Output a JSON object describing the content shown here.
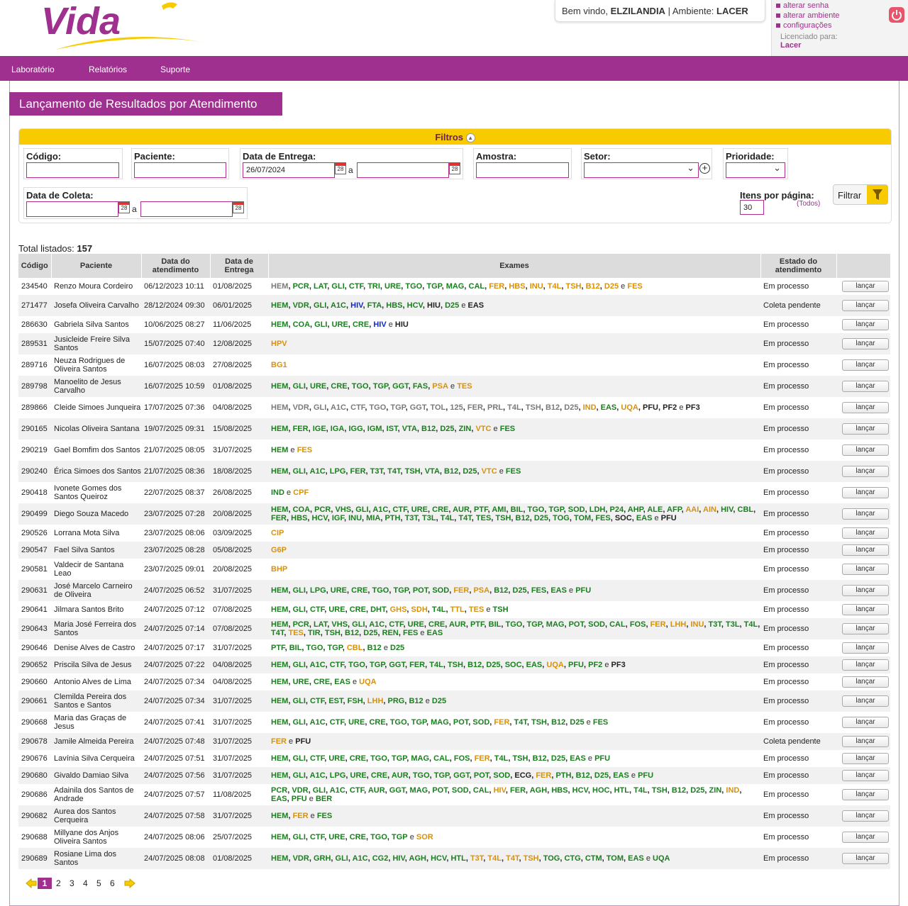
{
  "brand": {
    "logo_text": "Vida",
    "accent": "#a0308f",
    "yellow": "#f7cb00"
  },
  "header": {
    "welcome_prefix": "Bem vindo,",
    "user": "ELZILANDIA",
    "sep": "|",
    "env_label": "Ambiente:",
    "env": "LACER"
  },
  "userbox": {
    "links": [
      "alterar senha",
      "alterar ambiente",
      "configurações"
    ],
    "licensed_label": "Licenciado para:",
    "licensed_to": "Lacer",
    "power_icon": "power-icon"
  },
  "nav": [
    "Laboratório",
    "Relatórios",
    "Suporte"
  ],
  "page_title": "Lançamento de Resultados por Atendimento",
  "filters": {
    "title": "Filtros",
    "codigo": {
      "label": "Código:",
      "value": ""
    },
    "paciente": {
      "label": "Paciente:",
      "value": ""
    },
    "entrega": {
      "label": "Data de Entrega:",
      "from": "26/07/2024",
      "to": "",
      "a": "a"
    },
    "amostra": {
      "label": "Amostra:",
      "value": ""
    },
    "setor": {
      "label": "Setor:",
      "value": ""
    },
    "prioridade": {
      "label": "Prioridade:",
      "value": ""
    },
    "coleta": {
      "label": "Data de Coleta:",
      "from": "",
      "to": "",
      "a": "a"
    },
    "itens": {
      "label": "Itens por página:",
      "value": "30",
      "todos": "(Todos)"
    },
    "filtrar": "Filtrar",
    "cal_day": "28"
  },
  "total": {
    "label": "Total listados:",
    "value": "157"
  },
  "table": {
    "headers": [
      "Código",
      "Paciente",
      "Data do atendimento",
      "Data de Entrega",
      "Exames",
      "Estado do atendimento",
      ""
    ],
    "button": "lançar",
    "rows": [
      {
        "cod": "234540",
        "pac": "Renzo Moura Cordeiro",
        "dat": "06/12/2023 10:11",
        "ent": "01/08/2025",
        "ex": "HEM:a,PCR:g,LAT:g,GLI:g,CTF:g,TRI:g,URE:g,TGO:g,TGP:g,MAG:g,CAL:g,FER:o,HBS:o,INU:o,T4L:o,TSH:o,B12:o,D25:o,FES:o",
        "est": "Em processo"
      },
      {
        "cod": "271477",
        "pac": "Josefa Oliveira Carvalho",
        "dat": "28/12/2024 09:30",
        "ent": "06/01/2025",
        "ex": "HEM:g,VDR:g,GLI:g,A1C:g,HIV:b,FTA:g,HBS:g,HCV:g,HIU:k,D25:g,EAS:k",
        "est": "Coleta pendente"
      },
      {
        "cod": "286630",
        "pac": "Gabriela Silva Santos",
        "dat": "10/06/2025 08:27",
        "ent": "11/06/2025",
        "ex": "HEM:g,COA:g,GLI:g,URE:g,CRE:g,HIV:b,HIU:k",
        "est": "Em processo"
      },
      {
        "cod": "289531",
        "pac": "Jusicleide Freire Silva Santos",
        "dat": "15/07/2025 07:40",
        "ent": "12/08/2025",
        "ex": "HPV:o",
        "est": "Em processo"
      },
      {
        "cod": "289716",
        "pac": "Neuza Rodrigues de Oliveira Santos",
        "dat": "16/07/2025 08:03",
        "ent": "27/08/2025",
        "ex": "BG1:o",
        "est": "Em processo"
      },
      {
        "cod": "289798",
        "pac": "Manoelito de Jesus Carvalho",
        "dat": "16/07/2025 10:59",
        "ent": "01/08/2025",
        "ex": "HEM:g,GLI:g,URE:g,CRE:g,TGO:g,TGP:g,GGT:g,FAS:g,PSA:o,TES:o",
        "est": "Em processo"
      },
      {
        "cod": "289866",
        "pac": "Cleide Simoes Junqueira",
        "dat": "17/07/2025 07:36",
        "ent": "04/08/2025",
        "ex": "HEM:a,VDR:a,GLI:a,A1C:a,CTF:a,TGO:a,TGP:a,GGT:a,TOL:a,125:a,FER:a,PRL:a,T4L:a,TSH:a,B12:a,D25:a,IND:o,EAS:g,UQA:o,PFU:k,PF2:k,PF3:k",
        "est": "Em processo"
      },
      {
        "cod": "290165",
        "pac": "Nicolas Oliveira Santana",
        "dat": "19/07/2025 09:31",
        "ent": "15/08/2025",
        "ex": "HEM:g,FER:g,IGE:g,IGA:g,IGG:g,IGM:g,IST:g,VTA:g,B12:g,D25:g,ZIN:g,VTC:o,FES:g",
        "est": "Em processo"
      },
      {
        "cod": "290219",
        "pac": "Gael Bomfim dos Santos",
        "dat": "21/07/2025 08:05",
        "ent": "31/07/2025",
        "ex": "HEM:g,FES:o",
        "est": "Em processo"
      },
      {
        "cod": "290240",
        "pac": "Érica Simoes dos Santos",
        "dat": "21/07/2025 08:36",
        "ent": "18/08/2025",
        "ex": "HEM:g,GLI:g,A1C:g,LPG:g,FER:g,T3T:g,T4T:g,TSH:g,VTA:g,B12:g,D25:g,VTC:o,FES:g",
        "est": "Em processo"
      },
      {
        "cod": "290418",
        "pac": "Ivonete Gomes dos Santos Queiroz",
        "dat": "22/07/2025 08:37",
        "ent": "26/08/2025",
        "ex": "IND:g,CPF:o",
        "est": "Em processo"
      },
      {
        "cod": "290499",
        "pac": "Diego Souza Macedo",
        "dat": "23/07/2025 07:28",
        "ent": "20/08/2025",
        "ex": "HEM:g,COA:g,PCR:g,VHS:g,GLI:g,A1C:g,CTF:g,URE:g,CRE:g,AUR:g,PTF:g,AMI:g,BIL:g,TGO:g,TGP:g,SOD:g,LDH:g,P24:g,AHP:g,ALE:g,AFP:g,AAI:o,AIN:o,HIV:g,CBL:g,FER:g,HBS:g,HCV:g,IGF:g,INU:g,MIA:g,PTH:g,T3T:g,T3L:g,T4L:g,T4T:g,TES:g,TSH:g,B12:g,D25:g,TOG:g,TOM:g,FES:g,SOC:k,EAS:g,PFU:k",
        "est": "Em processo"
      },
      {
        "cod": "290526",
        "pac": "Lorrana Mota Silva",
        "dat": "23/07/2025 08:06",
        "ent": "03/09/2025",
        "ex": "CIP:o",
        "est": "Em processo"
      },
      {
        "cod": "290547",
        "pac": "Fael Silva Santos",
        "dat": "23/07/2025 08:28",
        "ent": "05/08/2025",
        "ex": "G6P:o",
        "est": "Em processo"
      },
      {
        "cod": "290581",
        "pac": "Valdecir de Santana Leao",
        "dat": "23/07/2025 09:01",
        "ent": "20/08/2025",
        "ex": "BHP:o",
        "est": "Em processo"
      },
      {
        "cod": "290631",
        "pac": "José Marcelo Carneiro de Oliveira",
        "dat": "24/07/2025 06:52",
        "ent": "31/07/2025",
        "ex": "HEM:g,GLI:g,LPG:g,URE:g,CRE:g,TGO:g,TGP:g,POT:g,SOD:g,FER:o,PSA:o,B12:g,D25:g,FES:g,EAS:g,PFU:g",
        "est": "Em processo"
      },
      {
        "cod": "290641",
        "pac": "Jilmara Santos Brito",
        "dat": "24/07/2025 07:12",
        "ent": "07/08/2025",
        "ex": "HEM:g,GLI:g,CTF:g,URE:g,CRE:g,DHT:g,GHS:o,SDH:o,T4L:g,TTL:o,TES:o,TSH:g",
        "est": "Em processo"
      },
      {
        "cod": "290643",
        "pac": "Maria José Ferreira dos Santos",
        "dat": "24/07/2025 07:14",
        "ent": "07/08/2025",
        "ex": "HEM:g,PCR:g,LAT:g,VHS:g,GLI:g,A1C:g,CTF:g,URE:g,CRE:g,AUR:g,PTF:g,BIL:g,TGO:g,TGP:g,MAG:g,POT:g,SOD:g,CAL:g,FOS:g,FER:o,LHH:o,INU:o,T3T:g,T3L:g,T4L:g,T4T:g,TES:o,TIR:g,TSH:g,B12:g,D25:g,REN:g,FES:g,EAS:g",
        "est": "Em processo"
      },
      {
        "cod": "290646",
        "pac": "Denise Alves de Castro",
        "dat": "24/07/2025 07:17",
        "ent": "31/07/2025",
        "ex": "PTF:g,BIL:g,TGO:g,TGP:g,CBL:o,B12:g,D25:g",
        "est": "Em processo"
      },
      {
        "cod": "290652",
        "pac": "Priscila Silva de Jesus",
        "dat": "24/07/2025 07:22",
        "ent": "04/08/2025",
        "ex": "HEM:g,GLI:g,A1C:g,CTF:g,TGO:g,TGP:g,GGT:g,FER:g,T4L:g,TSH:g,B12:g,D25:g,SOC:g,EAS:g,UQA:o,PFU:g,PF2:g,PF3:k",
        "est": "Em processo"
      },
      {
        "cod": "290660",
        "pac": "Antonio Alves de Lima",
        "dat": "24/07/2025 07:34",
        "ent": "04/08/2025",
        "ex": "HEM:g,URE:g,CRE:g,EAS:g,UQA:o",
        "est": "Em processo"
      },
      {
        "cod": "290661",
        "pac": "Clemilda Pereira dos Santos e Santos",
        "dat": "24/07/2025 07:34",
        "ent": "31/07/2025",
        "ex": "HEM:g,GLI:g,CTF:g,EST:g,FSH:g,LHH:o,PRG:g,B12:g,D25:g",
        "est": "Em processo"
      },
      {
        "cod": "290668",
        "pac": "Maria das Graças de Jesus",
        "dat": "24/07/2025 07:41",
        "ent": "31/07/2025",
        "ex": "HEM:g,GLI:g,A1C:g,CTF:g,URE:g,CRE:g,TGO:g,TGP:g,MAG:g,POT:g,SOD:g,FER:o,T4T:g,TSH:g,B12:g,D25:g,FES:g",
        "est": "Em processo"
      },
      {
        "cod": "290678",
        "pac": "Jamile Almeida Pereira",
        "dat": "24/07/2025 07:48",
        "ent": "31/07/2025",
        "ex": "FER:o,PFU:k",
        "est": "Coleta pendente"
      },
      {
        "cod": "290676",
        "pac": "Lavínia Silva Cerqueira",
        "dat": "24/07/2025 07:51",
        "ent": "31/07/2025",
        "ex": "HEM:g,GLI:g,CTF:g,URE:g,CRE:g,TGO:g,TGP:g,MAG:g,CAL:g,FOS:g,FER:o,T4L:g,TSH:g,B12:g,D25:g,EAS:g,PFU:g",
        "est": "Em processo"
      },
      {
        "cod": "290680",
        "pac": "Givaldo Damiao Silva",
        "dat": "24/07/2025 07:56",
        "ent": "31/07/2025",
        "ex": "HEM:g,GLI:g,A1C:g,LPG:g,URE:g,CRE:g,AUR:g,TGO:g,TGP:g,GGT:g,POT:g,SOD:g,ECG:k,FER:o,PTH:g,B12:g,D25:g,EAS:g,PFU:g",
        "est": "Em processo"
      },
      {
        "cod": "290686",
        "pac": "Adainila dos Santos de Andrade",
        "dat": "24/07/2025 07:57",
        "ent": "11/08/2025",
        "ex": "PCR:g,VDR:g,GLI:g,A1C:g,CTF:g,AUR:g,GGT:g,MAG:g,POT:g,SOD:g,CAL:g,HIV:o,FER:g,AGH:g,HBS:g,HCV:g,HOC:g,HTL:g,T4L:g,TSH:g,B12:g,D25:g,ZIN:g,IND:o,EAS:g,PFU:g,BER:g",
        "est": "Em processo"
      },
      {
        "cod": "290682",
        "pac": "Aurea dos Santos Cerqueira",
        "dat": "24/07/2025 07:58",
        "ent": "31/07/2025",
        "ex": "HEM:g,FER:o,FES:g",
        "est": "Em processo"
      },
      {
        "cod": "290688",
        "pac": "Millyane dos Anjos Oliveira Santos",
        "dat": "24/07/2025 08:06",
        "ent": "25/07/2025",
        "ex": "HEM:g,GLI:g,CTF:g,URE:g,CRE:g,TGO:g,TGP:g,SOR:o",
        "est": "Em processo"
      },
      {
        "cod": "290689",
        "pac": "Rosiane Lima dos Santos",
        "dat": "24/07/2025 08:08",
        "ent": "01/08/2025",
        "ex": "HEM:g,VDR:g,GRH:g,GLI:g,A1C:g,CG2:g,HIV:g,AGH:g,HCV:g,HTL:g,T3T:o,T4L:o,T4T:o,TSH:o,TOG:g,CTG:g,CTM:g,TOM:g,EAS:g,UQA:g",
        "est": "Em processo"
      }
    ]
  },
  "pager": {
    "current": "1",
    "pages": [
      "2",
      "3",
      "4",
      "5",
      "6"
    ],
    "prev_icon": "arrow-left-icon",
    "next_icon": "arrow-right-icon"
  }
}
